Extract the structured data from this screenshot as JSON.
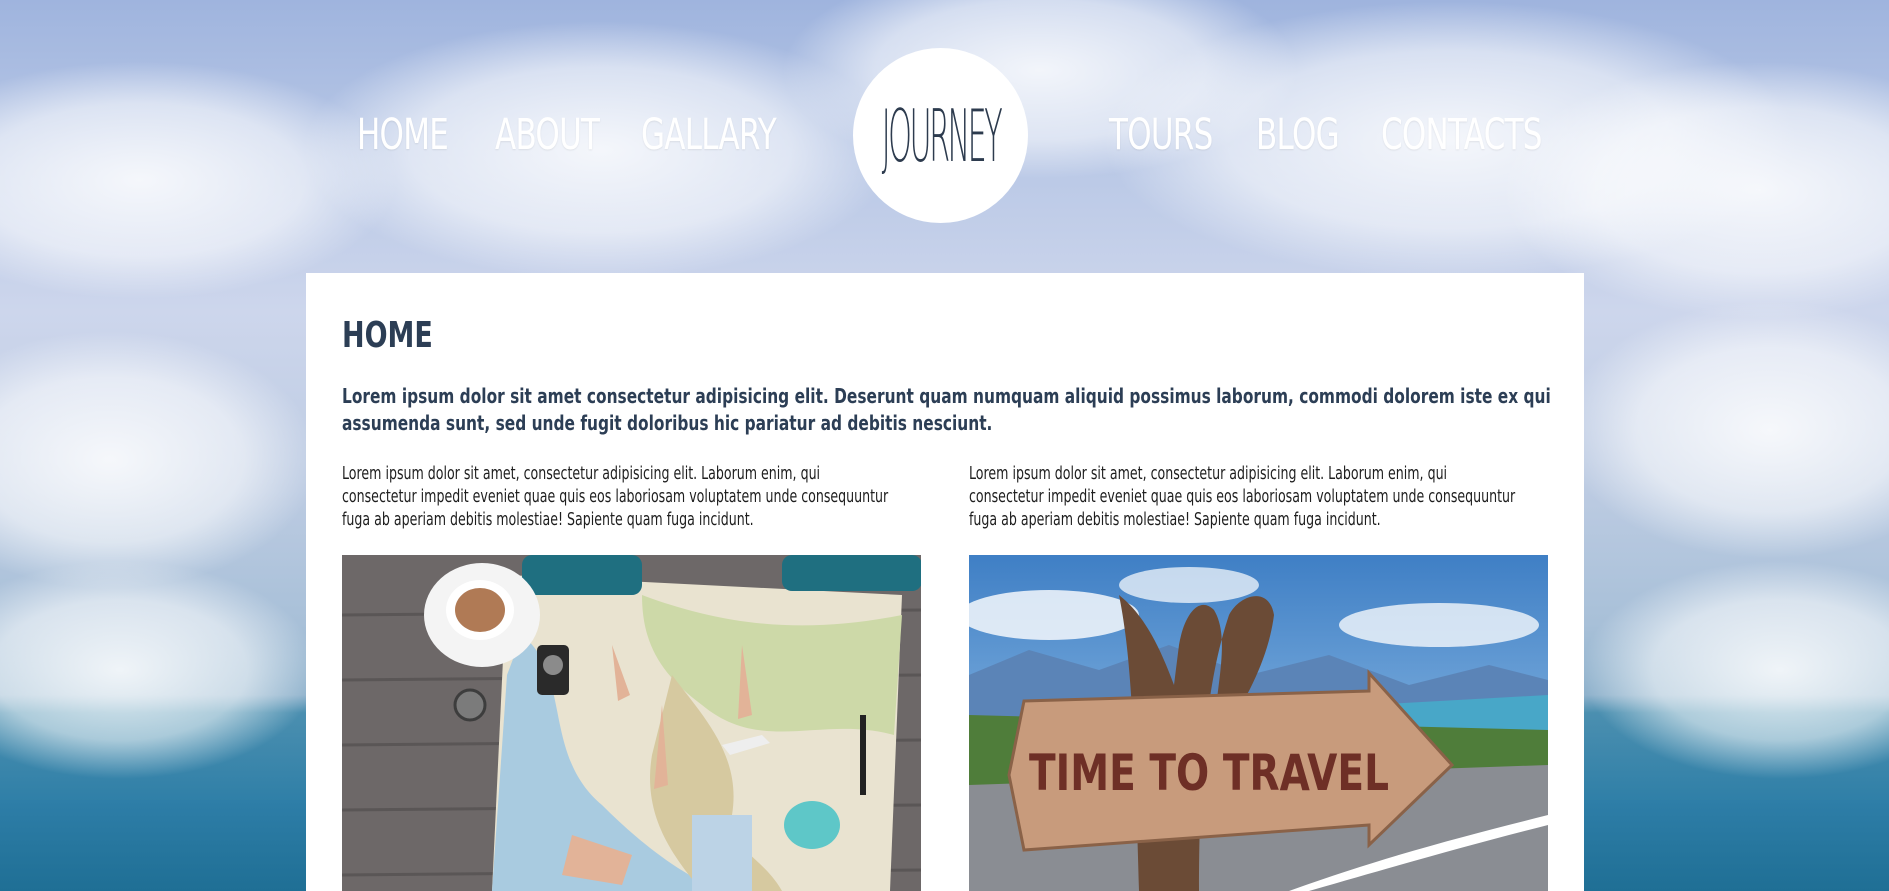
{
  "nav": {
    "left": [
      "HOME",
      "ABOUT",
      "GALLARY"
    ],
    "right": [
      "TOURS",
      "BLOG",
      "CONTACTS"
    ],
    "logo": "JOURNEY"
  },
  "content": {
    "title": "HOME",
    "lead": "Lorem ipsum dolor sit amet consectetur adipisicing elit. Deserunt quam numquam aliquid possimus laborum, commodi dolorem iste ex qui assumenda sunt, sed unde fugit doloribus hic pariatur ad debitis nesciunt.",
    "columns": [
      {
        "text": "Lorem ipsum dolor sit amet, consectetur adipisicing elit. Laborum enim, qui consectetur impedit eveniet quae quis eos laboriosam voluptatem unde consequuntur fuga ab aperiam debitis molestiae! Sapiente quam fuga incidunt.",
        "image": "travel-map-photo"
      },
      {
        "text": "Lorem ipsum dolor sit amet, consectetur adipisicing elit. Laborum enim, qui consectetur impedit eveniet quae quis eos laboriosam voluptatem unde consequuntur fuga ab aperiam debitis molestiae! Sapiente quam fuga incidunt.",
        "image": "time-to-travel-sign-photo",
        "sign_text": "TIME TO TRAVEL"
      }
    ]
  },
  "colors": {
    "heading": "#2c3e55",
    "logo_bg": "#ffffff",
    "nav_text": "#ffffff"
  }
}
